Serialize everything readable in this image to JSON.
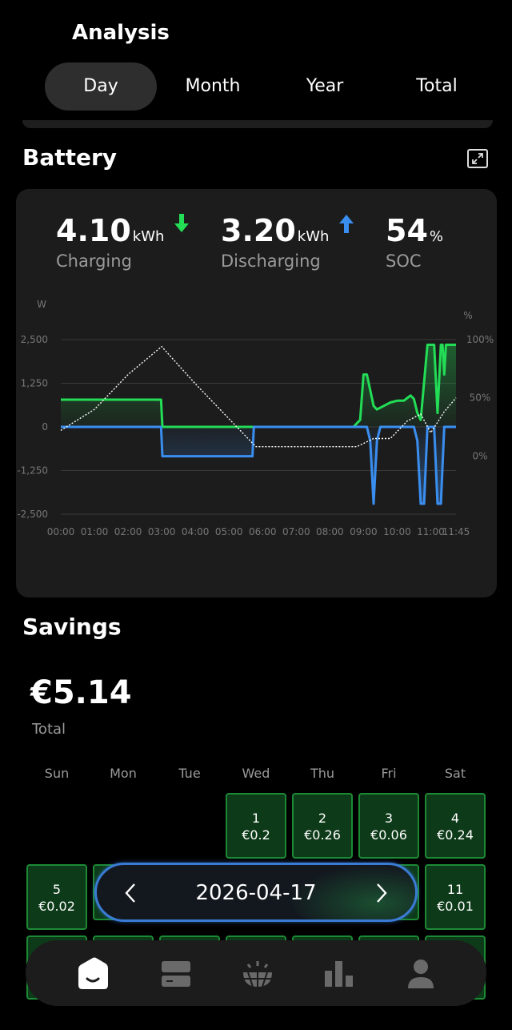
{
  "header": {
    "title": "Analysis"
  },
  "tabs": [
    {
      "label": "Day",
      "active": true
    },
    {
      "label": "Month",
      "active": false
    },
    {
      "label": "Year",
      "active": false
    },
    {
      "label": "Total",
      "active": false
    }
  ],
  "battery": {
    "title": "Battery",
    "charging": {
      "value": "4.10",
      "unit": "kWh",
      "label": "Charging"
    },
    "discharging": {
      "value": "3.20",
      "unit": "kWh",
      "label": "Discharging"
    },
    "soc": {
      "value": "54",
      "unit": "%",
      "label": "SOC"
    }
  },
  "colors": {
    "charge": "#22dd55",
    "discharge": "#3a8ef0",
    "soc": "#ffffff",
    "card": "#1c1c1c"
  },
  "chart_data": {
    "type": "line",
    "ylabel": "W",
    "y2label": "%",
    "ylim": [
      -2500,
      2500
    ],
    "y2lim": [
      -50,
      100
    ],
    "yticks": [
      "2,500",
      "1,250",
      "0",
      "-1,250",
      "-2,500"
    ],
    "y2ticks": [
      "100%",
      "50%",
      "0%"
    ],
    "xticks": [
      "00:00",
      "01:00",
      "02:00",
      "03:00",
      "04:00",
      "05:00",
      "06:00",
      "07:00",
      "08:00",
      "09:00",
      "10:00",
      "11:00",
      "11:45"
    ],
    "xlim": [
      0,
      11.75
    ],
    "series": [
      {
        "name": "charging",
        "x": [
          0,
          2.98,
          3.02,
          8.7,
          8.9,
          9.0,
          9.1,
          9.3,
          9.4,
          9.6,
          9.8,
          10.0,
          10.2,
          10.4,
          10.5,
          10.6,
          10.7,
          10.9,
          11.0,
          11.1,
          11.2,
          11.3,
          11.35,
          11.4,
          11.45,
          11.55,
          11.75
        ],
        "y": [
          780,
          780,
          0,
          0,
          200,
          1500,
          1500,
          600,
          500,
          600,
          700,
          750,
          750,
          900,
          800,
          400,
          200,
          2350,
          2350,
          2350,
          400,
          2350,
          2350,
          1500,
          2350,
          2350,
          2350
        ]
      },
      {
        "name": "discharging",
        "x": [
          0,
          2.98,
          3.02,
          5.7,
          5.74,
          9.1,
          9.2,
          9.3,
          9.4,
          9.5,
          10.5,
          10.6,
          10.7,
          10.8,
          10.9,
          11.1,
          11.2,
          11.3,
          11.4,
          11.5,
          11.75
        ],
        "y": [
          0,
          0,
          -840,
          -840,
          0,
          0,
          -400,
          -2200,
          -400,
          0,
          0,
          -400,
          -2200,
          -2200,
          0,
          0,
          -2200,
          -2200,
          0,
          0,
          0
        ]
      },
      {
        "name": "soc",
        "x": [
          0,
          1,
          2,
          3.0,
          4,
          5,
          5.8,
          7,
          8,
          8.8,
          9.3,
          9.8,
          10.3,
          10.7,
          11.0,
          11.4,
          11.75
        ],
        "y": [
          22,
          40,
          70,
          94,
          62,
          32,
          8,
          8,
          8,
          8,
          15,
          15,
          30,
          36,
          20,
          38,
          50
        ]
      }
    ]
  },
  "savings": {
    "title": "Savings",
    "total_value": "€5.14",
    "total_label": "Total",
    "weekdays": [
      "Sun",
      "Mon",
      "Tue",
      "Wed",
      "Thu",
      "Fri",
      "Sat"
    ],
    "days": [
      {
        "day": "1",
        "value": "€0.2",
        "col": 3,
        "row": 0
      },
      {
        "day": "2",
        "value": "€0.26",
        "col": 4,
        "row": 0
      },
      {
        "day": "3",
        "value": "€0.06",
        "col": 5,
        "row": 0
      },
      {
        "day": "4",
        "value": "€0.24",
        "col": 6,
        "row": 0
      },
      {
        "day": "5",
        "value": "€0.02",
        "col": 0,
        "row": 1
      },
      {
        "day": "11",
        "value": "€0.01",
        "col": 6,
        "row": 1
      }
    ]
  },
  "date_nav": {
    "date": "2026-04-17"
  },
  "bottom_nav": [
    {
      "icon": "home-icon",
      "active": true
    },
    {
      "icon": "devices-icon",
      "active": false
    },
    {
      "icon": "solar-panel-icon",
      "active": false
    },
    {
      "icon": "statistics-icon",
      "active": false
    },
    {
      "icon": "profile-icon",
      "active": false
    }
  ]
}
